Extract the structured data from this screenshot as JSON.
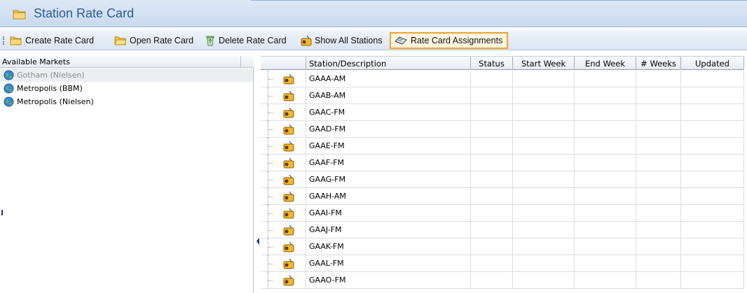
{
  "window": {
    "title": "Station Rate Card"
  },
  "toolbar": {
    "create": "Create Rate Card",
    "open": "Open Rate Card",
    "delete": "Delete Rate Card",
    "show_all": "Show All Stations",
    "assignments": "Rate Card Assignments"
  },
  "markets": {
    "header": "Available Markets",
    "items": [
      {
        "label": "Gotham (Nielsen)"
      },
      {
        "label": "Metropolis (BBM)"
      },
      {
        "label": "Metropolis (Nielsen)"
      }
    ]
  },
  "grid": {
    "columns": {
      "station": "Station/Description",
      "status": "Status",
      "start": "Start Week",
      "end": "End Week",
      "weeks": "# Weeks",
      "updated": "Updated"
    },
    "rows": [
      {
        "station": "GAAA-AM"
      },
      {
        "station": "GAAB-AM"
      },
      {
        "station": "GAAC-FM"
      },
      {
        "station": "GAAD-FM"
      },
      {
        "station": "GAAE-FM"
      },
      {
        "station": "GAAF-FM"
      },
      {
        "station": "GAAG-FM"
      },
      {
        "station": "GAAH-AM"
      },
      {
        "station": "GAAI-FM"
      },
      {
        "station": "GAAJ-FM"
      },
      {
        "station": "GAAK-FM"
      },
      {
        "station": "GAAL-FM"
      },
      {
        "station": "GAAO-FM"
      }
    ]
  }
}
